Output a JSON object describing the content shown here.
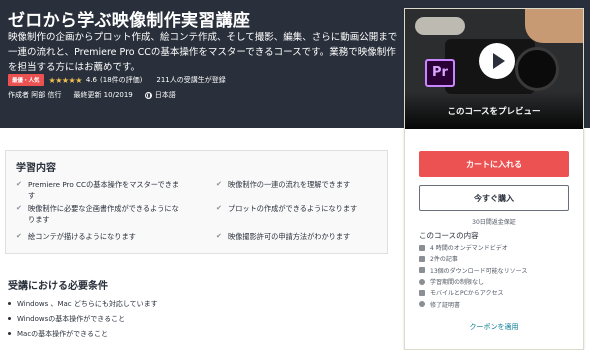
{
  "course": {
    "title": "ゼロから学ぶ映像制作実習講座",
    "description": "映像制作の企画からプロット作成、絵コンテ作成、そして撮影、編集、さらに動画公開まで一連の流れと、Premiere Pro CCの基本操作をマスターできるコースです。業務で映像制作を担当する方にはお薦めです。",
    "badge": "最優・人気",
    "stars": "★★★★★",
    "rating": "4.6",
    "reviews": "(18件の評価)",
    "students": "211人の受講生が登録",
    "author": "作成者 阿部 信行",
    "updated": "最終更新 10/2019",
    "language": "日本語"
  },
  "sidebar": {
    "preview_label": "このコースをプレビュー",
    "logo_text": "Pr",
    "cart_button": "カートに入れる",
    "buy_button": "今すぐ購入",
    "guarantee": "30日間返金保証",
    "includes_title": "このコースの内容",
    "includes": [
      {
        "label": "4 時間のオンデマンドビデオ",
        "icon": "video-icon"
      },
      {
        "label": "2件の記事",
        "icon": "article-icon"
      },
      {
        "label": "13個のダウンロード可能なリソース",
        "icon": "download-icon"
      },
      {
        "label": "学習期間の制限なし",
        "icon": "infinity-icon"
      },
      {
        "label": "モバイルとPCからアクセス",
        "icon": "mobile-icon"
      },
      {
        "label": "修了証明書",
        "icon": "certificate-icon"
      }
    ],
    "coupon": "クーポンを適用"
  },
  "learn": {
    "title": "学習内容",
    "items": [
      "Premiere Pro CCの基本操作をマスターできます",
      "映像制作の一連の流れを理解できます",
      "映像制作に必要な企画書作成ができるようになります",
      "プロットの作成ができるようになります",
      "絵コンテが描けるようになります",
      "映像撮影許可の申請方法がわかります"
    ]
  },
  "requirements": {
    "title": "受講における必要条件",
    "items": [
      "Windows 、Mac どちらにも対応しています",
      "Windowsの基本操作ができること",
      "Macの基本操作ができること"
    ]
  },
  "colors": {
    "hero_bg": "#29303b",
    "accent_red": "#ec5252",
    "star": "#f4c150",
    "link": "#007791"
  }
}
